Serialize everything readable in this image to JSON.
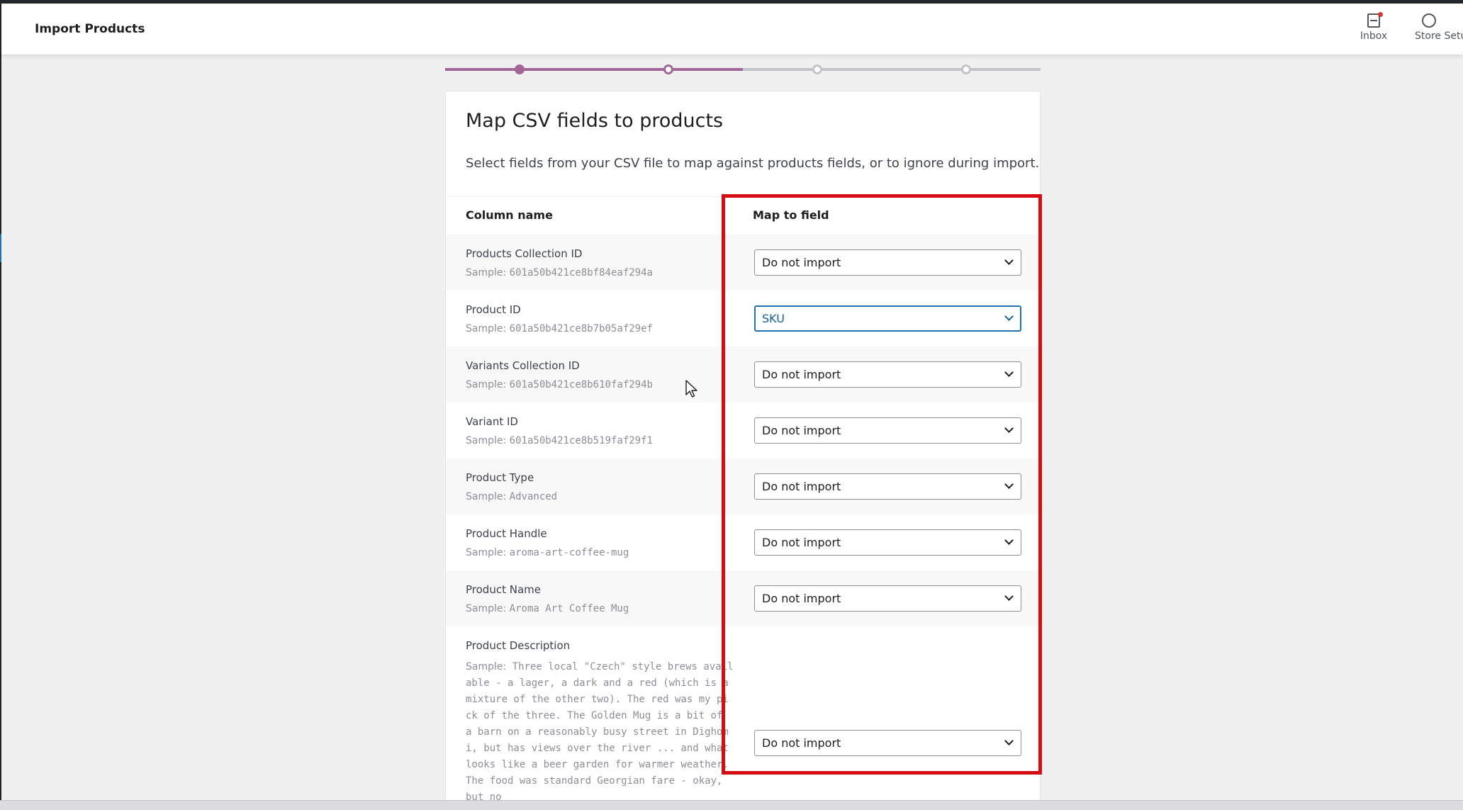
{
  "header": {
    "title": "Import Products",
    "inbox_label": "Inbox",
    "store_label": "Store Setup"
  },
  "progress": {
    "steps_total": 4,
    "current_step": 2
  },
  "card": {
    "title": "Map CSV fields to products",
    "description": "Select fields from your CSV file to map against products fields, or to ignore during import."
  },
  "table": {
    "col_name_header": "Column name",
    "col_map_header": "Map to field",
    "sample_prefix": "Sample:",
    "rows": [
      {
        "name": "Products Collection ID",
        "sample": "601a50b421ce8bf84eaf294a",
        "map": "Do not import"
      },
      {
        "name": "Product ID",
        "sample": "601a50b421ce8b7b05af29ef",
        "map": "SKU"
      },
      {
        "name": "Variants Collection ID",
        "sample": "601a50b421ce8b610faf294b",
        "map": "Do not import"
      },
      {
        "name": "Variant ID",
        "sample": "601a50b421ce8b519faf29f1",
        "map": "Do not import"
      },
      {
        "name": "Product Type",
        "sample": "Advanced",
        "map": "Do not import"
      },
      {
        "name": "Product Handle",
        "sample": "aroma-art-coffee-mug",
        "map": "Do not import"
      },
      {
        "name": "Product Name",
        "sample": "Aroma Art Coffee Mug",
        "map": "Do not import"
      },
      {
        "name": "Product Description",
        "sample": "Three local \"Czech\" style brews available - a lager, a dark and a red (which is a mixture of the other two). The red was my pick of the three. The Golden Mug is a bit of a barn on a reasonably busy street in Dighomi, but has views over the river ... and what looks like a beer garden for warmer weather. The food was standard Georgian fare - okay, but no",
        "map": "Do not import"
      }
    ]
  },
  "colors": {
    "accent": "#a16696",
    "highlight": "#d40d12",
    "focus": "#2271b1"
  },
  "icons": {
    "inbox": "inbox-icon",
    "store": "store-setup-icon",
    "cursor": "mouse-cursor-icon"
  }
}
